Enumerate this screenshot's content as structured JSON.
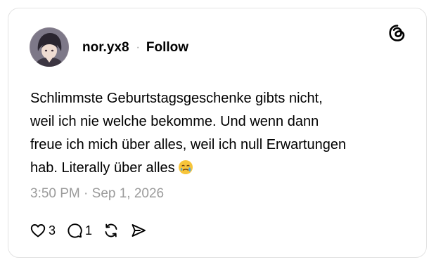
{
  "post": {
    "username": "nor.yx8",
    "separator": "·",
    "follow_label": "Follow",
    "text": "Schlimmste Geburtstagsgeschenke gibts nicht,\nweil ich nie welche bekomme. Und wenn dann\nfreue ich mich über alles, weil ich null Erwartungen\nhab. Literally über alles",
    "emoji": "face-holding-back-tears-emoji",
    "timestamp": "3:50 PM · Sep 1, 2026"
  },
  "actions": {
    "like_icon": "heart-icon",
    "like_count": "3",
    "reply_icon": "comment-icon",
    "reply_count": "1",
    "repost_icon": "repost-icon",
    "share_icon": "send-icon"
  },
  "brand": {
    "logo": "threads-logo-icon"
  },
  "colors": {
    "text": "#000000",
    "muted": "#9b9b9b",
    "border": "#e3e3e3",
    "background": "#ffffff"
  }
}
